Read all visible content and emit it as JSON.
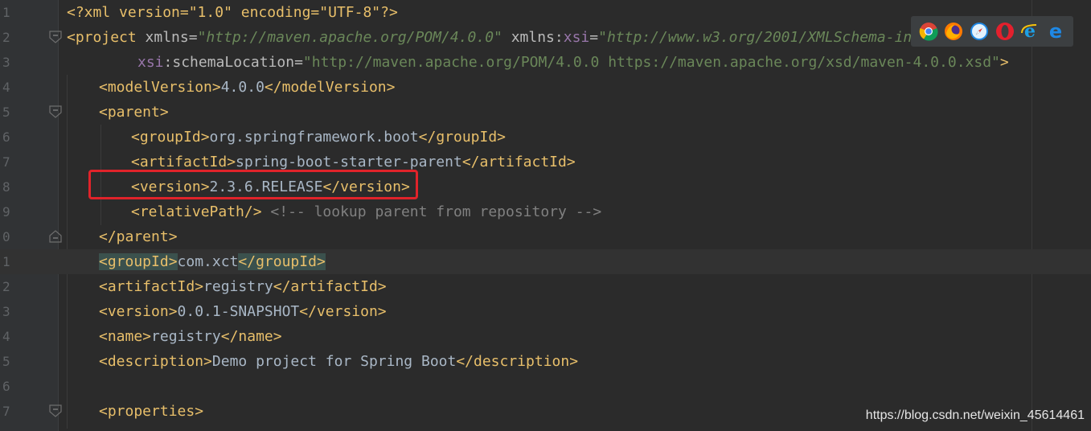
{
  "editor": {
    "lines": [
      {
        "num": "1",
        "pi": "<?xml version=\"1.0\" encoding=\"UTF-8\"?>"
      },
      {
        "num": "2",
        "open": "<",
        "tag": "project",
        "attr1": " xmlns",
        "eq1": "=",
        "val1": "\"http://maven.apache.org/POM/4.0.0\"",
        "attr2ns": " xmlns",
        "colon": ":",
        "attr2": "xsi",
        "eq2": "=",
        "val2": "\"http://www.w3.org/2001/XMLSchema-instance\""
      },
      {
        "num": "3",
        "attrns": "xsi",
        "colon": ":",
        "attr": "schemaLocation",
        "eq": "=",
        "val": "\"http://maven.apache.org/POM/4.0.0 https://maven.apache.org/xsd/maven-4.0.0.xsd\"",
        "close": ">"
      },
      {
        "num": "4",
        "open": "<modelVersion>",
        "text": "4.0.0",
        "close": "</modelVersion>"
      },
      {
        "num": "5",
        "open": "<parent>"
      },
      {
        "num": "6",
        "open": "<groupId>",
        "text": "org.springframework.boot",
        "close": "</groupId>"
      },
      {
        "num": "7",
        "open": "<artifactId>",
        "text": "spring-boot-starter-parent",
        "close": "</artifactId>"
      },
      {
        "num": "8",
        "open": "<version>",
        "text": "2.3.6.RELEASE",
        "close": "</version>"
      },
      {
        "num": "9",
        "open": "<relativePath/>",
        "comment": " <!-- lookup parent from repository -->"
      },
      {
        "num": "0",
        "open": "</parent>"
      },
      {
        "num": "1",
        "open": "<groupId>",
        "text": "com.xct",
        "close": "</groupId>"
      },
      {
        "num": "2",
        "open": "<artifactId>",
        "text": "registry",
        "close": "</artifactId>"
      },
      {
        "num": "3",
        "open": "<version>",
        "text": "0.0.1-SNAPSHOT",
        "close": "</version>"
      },
      {
        "num": "4",
        "open": "<name>",
        "text": "registry",
        "close": "</name>"
      },
      {
        "num": "5",
        "open": "<description>",
        "text": "Demo project for Spring Boot",
        "close": "</description>"
      },
      {
        "num": "6"
      },
      {
        "num": "7",
        "open": "<properties>"
      }
    ]
  },
  "browser_icons": [
    "chrome-icon",
    "firefox-icon",
    "safari-icon",
    "opera-icon",
    "ie-icon",
    "edge-icon"
  ],
  "colors": {
    "background": "#2b2b2b",
    "tag": "#e8bf6a",
    "string": "#6a8759",
    "namespace": "#9876aa",
    "comment": "#629755",
    "highlight_box": "#e0232a"
  },
  "watermark": "https://blog.csdn.net/weixin_45614461"
}
